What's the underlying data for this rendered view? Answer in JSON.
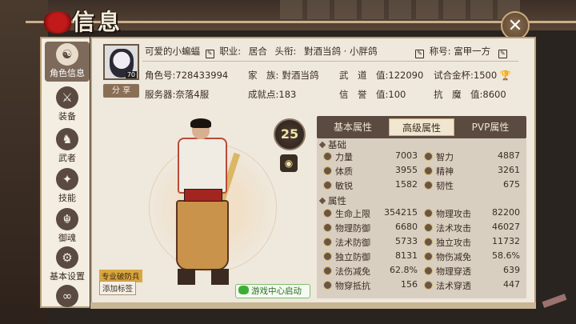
{
  "title": "信息",
  "close_icon": "close-x-icon",
  "sidebar": [
    {
      "label": "角色信息",
      "icon": "character-icon",
      "active": true
    },
    {
      "label": "装备",
      "icon": "equipment-icon"
    },
    {
      "label": "武者",
      "icon": "warrior-icon"
    },
    {
      "label": "技能",
      "icon": "skill-icon"
    },
    {
      "label": "御魂",
      "icon": "soul-icon"
    },
    {
      "label": "基本设置",
      "icon": "settings-icon"
    }
  ],
  "profile": {
    "name": "可爱的小蝙蝠",
    "job_label": "职业:",
    "job": "居合",
    "head_title_label": "头衔:",
    "head_title": "對酒当鸽 · 小胖鸽",
    "nickname_label": "称号:",
    "nickname": "富甲一方",
    "avatar_level": "70",
    "share": "分 享",
    "role_id_label": "角色号:",
    "role_id": "728433994",
    "family_label": "家　族:",
    "family": "對酒当鸽",
    "wudao_label": "武　道　值:",
    "wudao": "122090",
    "trial_label": "试合金杯:",
    "trial": "1500",
    "server_label": "服务器:",
    "server": "奈落4服",
    "achievement_label": "成就点:",
    "achievement": "183",
    "credit_label": "信　誉　值:",
    "credit": "100",
    "demon_label": "抗　魔　值:",
    "demon": "8600"
  },
  "level": "25",
  "tags": {
    "tag1": "专业破防兵",
    "tag2": "添加标签"
  },
  "wechat_button": "游戏中心启动",
  "tabs": [
    "基本属性",
    "高级属性",
    "PVP属性"
  ],
  "active_tab": 1,
  "sections": {
    "basic": "基础",
    "attrs": "属性"
  },
  "basic_stats": [
    {
      "l": "力量",
      "v": "7003"
    },
    {
      "l": "智力",
      "v": "4887"
    },
    {
      "l": "体质",
      "v": "3955"
    },
    {
      "l": "精神",
      "v": "3261"
    },
    {
      "l": "敏锐",
      "v": "1582"
    },
    {
      "l": "韧性",
      "v": "675"
    }
  ],
  "attr_stats": [
    {
      "l": "生命上限",
      "v": "354215"
    },
    {
      "l": "物理攻击",
      "v": "82200"
    },
    {
      "l": "物理防御",
      "v": "6680"
    },
    {
      "l": "法术攻击",
      "v": "46027"
    },
    {
      "l": "法术防御",
      "v": "5733"
    },
    {
      "l": "独立攻击",
      "v": "11732"
    },
    {
      "l": "独立防御",
      "v": "8131"
    },
    {
      "l": "物伤减免",
      "v": "58.6%"
    },
    {
      "l": "法伤减免",
      "v": "62.8%"
    },
    {
      "l": "物理穿透",
      "v": "639"
    },
    {
      "l": "物穿抵抗",
      "v": "156"
    },
    {
      "l": "法术穿透",
      "v": "447"
    }
  ]
}
